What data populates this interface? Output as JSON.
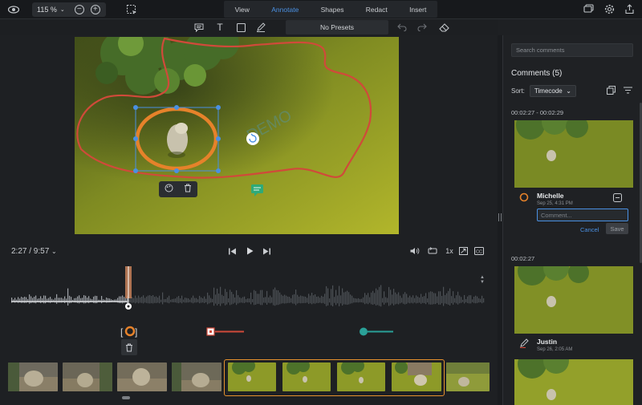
{
  "topbar": {
    "zoom_value": "115 %",
    "tabs": [
      "View",
      "Annotate",
      "Shapes",
      "Redact",
      "Insert"
    ],
    "active_tab": "Annotate"
  },
  "toolbar": {
    "presets_label": "No Presets"
  },
  "video": {
    "watermark_text": "DEMO"
  },
  "playback": {
    "timecode": "2:27 / 9:57",
    "speed": "1x"
  },
  "panel": {
    "search_placeholder": "Search comments",
    "comments_title": "Comments (5)",
    "sort_label": "Sort:",
    "sort_value": "Timecode",
    "comments": [
      {
        "range": "00:02:27 - 00:02:29",
        "author": "Michelle",
        "date": "Sep 25, 4:31 PM",
        "input_placeholder": "Comment...",
        "cancel_label": "Cancel",
        "save_label": "Save"
      },
      {
        "range": "00:02:27",
        "author": "Justin",
        "date": "Sep 26, 2:05 AM"
      }
    ]
  },
  "colors": {
    "accent": "#4a90e2",
    "annotation_orange": "#e6822a",
    "annotation_red": "#d04a3a",
    "track_teal": "#2aa198",
    "selection_range": "#e6912d"
  }
}
